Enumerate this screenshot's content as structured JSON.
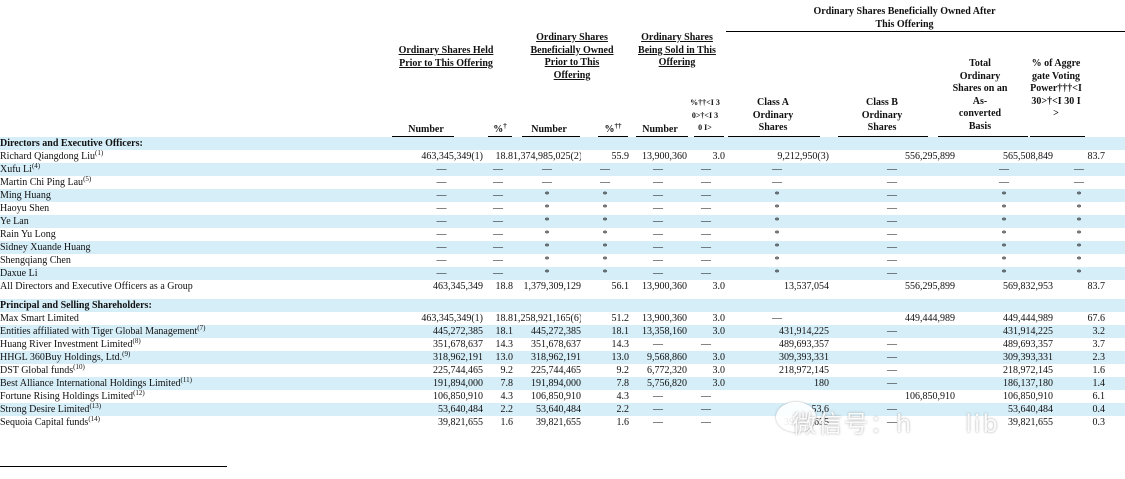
{
  "headers": {
    "group_after": "Ordinary Shares Beneficially Owned After This Offering",
    "held_prior": "Ordinary Shares Held Prior to This Offering",
    "beneficially_owned_prior": "Ordinary Shares Beneficially Owned Prior to This Offering",
    "being_sold": "Ordinary Shares Being Sold in This Offering",
    "number_1": "Number",
    "pct_1": "%",
    "pct_1_mark": "†",
    "number_2": "Number",
    "pct_2": "%",
    "pct_2_mark": "††",
    "number_3": "Number",
    "pct_3": "%††<I 30>†<I 30 I>",
    "class_a": "Class A Ordinary Shares",
    "class_b": "Class B Ordinary Shares",
    "total_asconverted": "Total Ordinary Shares on an As-converted Basis",
    "aggregate_voting": "% of Aggregate Voting Power†††<I 30>†<I 30 I>"
  },
  "sections": {
    "directors": "Directors and Executive Officers:",
    "principal": "Principal and Selling Shareholders:"
  },
  "directors": [
    {
      "name": "Richard Qiangdong Liu",
      "fn": "(1)",
      "c1": "463,345,349(1)",
      "c2": "18.8",
      "c3": "1,374,985,025(2)",
      "c4": "55.9",
      "c5": "13,900,360",
      "c6": "3.0",
      "c7": "9,212,950(3)",
      "c8": "556,295,899",
      "c9": "565,508,849",
      "c10": "83.7"
    },
    {
      "name": "Xufu Li",
      "fn": "(4)",
      "c1": "—",
      "c2": "—",
      "c3": "—",
      "c4": "—",
      "c5": "—",
      "c6": "—",
      "c7": "—",
      "c8": "—",
      "c9": "—",
      "c10": "—"
    },
    {
      "name": "Martin Chi Ping Lau",
      "fn": "(5)",
      "c1": "—",
      "c2": "—",
      "c3": "—",
      "c4": "—",
      "c5": "—",
      "c6": "—",
      "c7": "—",
      "c8": "—",
      "c9": "—",
      "c10": "—"
    },
    {
      "name": "Ming Huang",
      "fn": "",
      "c1": "—",
      "c2": "—",
      "c3": "*",
      "c4": "*",
      "c5": "—",
      "c6": "—",
      "c7": "*",
      "c8": "—",
      "c9": "*",
      "c10": "*"
    },
    {
      "name": "Haoyu Shen",
      "fn": "",
      "c1": "—",
      "c2": "—",
      "c3": "*",
      "c4": "*",
      "c5": "—",
      "c6": "—",
      "c7": "*",
      "c8": "—",
      "c9": "*",
      "c10": "*"
    },
    {
      "name": "Ye Lan",
      "fn": "",
      "c1": "—",
      "c2": "—",
      "c3": "*",
      "c4": "*",
      "c5": "—",
      "c6": "—",
      "c7": "*",
      "c8": "—",
      "c9": "*",
      "c10": "*"
    },
    {
      "name": "Rain Yu Long",
      "fn": "",
      "c1": "—",
      "c2": "—",
      "c3": "*",
      "c4": "*",
      "c5": "—",
      "c6": "—",
      "c7": "*",
      "c8": "—",
      "c9": "*",
      "c10": "*"
    },
    {
      "name": "Sidney Xuande Huang",
      "fn": "",
      "c1": "—",
      "c2": "—",
      "c3": "*",
      "c4": "*",
      "c5": "—",
      "c6": "—",
      "c7": "*",
      "c8": "—",
      "c9": "*",
      "c10": "*"
    },
    {
      "name": "Shengqiang Chen",
      "fn": "",
      "c1": "—",
      "c2": "—",
      "c3": "*",
      "c4": "*",
      "c5": "—",
      "c6": "—",
      "c7": "*",
      "c8": "—",
      "c9": "*",
      "c10": "*"
    },
    {
      "name": "Daxue Li",
      "fn": "",
      "c1": "—",
      "c2": "—",
      "c3": "*",
      "c4": "*",
      "c5": "—",
      "c6": "—",
      "c7": "*",
      "c8": "—",
      "c9": "*",
      "c10": "*"
    },
    {
      "name": "All Directors and Executive Officers as a Group",
      "fn": "",
      "c1": "463,345,349",
      "c2": "18.8",
      "c3": "1,379,309,129",
      "c4": "56.1",
      "c5": "13,900,360",
      "c6": "3.0",
      "c7": "13,537,054",
      "c8": "556,295,899",
      "c9": "569,832,953",
      "c10": "83.7"
    }
  ],
  "principals": [
    {
      "name": "Max Smart Limited",
      "fn": "",
      "c1": "463,345,349(1)",
      "c2": "18.8",
      "c3": "1,258,921,165(6)",
      "c4": "51.2",
      "c5": "13,900,360",
      "c6": "3.0",
      "c7": "—",
      "c8": "449,444,989",
      "c9": "449,444,989",
      "c10": "67.6"
    },
    {
      "name": "Entities affiliated with Tiger Global Management",
      "fn": "(7)",
      "c1": "445,272,385",
      "c2": "18.1",
      "c3": "445,272,385",
      "c4": "18.1",
      "c5": "13,358,160",
      "c6": "3.0",
      "c7": "431,914,225",
      "c8": "—",
      "c9": "431,914,225",
      "c10": "3.2"
    },
    {
      "name": "Huang River Investment Limited",
      "fn": "(8)",
      "c1": "351,678,637",
      "c2": "14.3",
      "c3": "351,678,637",
      "c4": "14.3",
      "c5": "—",
      "c6": "—",
      "c7": "489,693,357",
      "c8": "—",
      "c9": "489,693,357",
      "c10": "3.7"
    },
    {
      "name": "HHGL 360Buy Holdings, Ltd.",
      "fn": "(9)",
      "c1": "318,962,191",
      "c2": "13.0",
      "c3": "318,962,191",
      "c4": "13.0",
      "c5": "9,568,860",
      "c6": "3.0",
      "c7": "309,393,331",
      "c8": "—",
      "c9": "309,393,331",
      "c10": "2.3"
    },
    {
      "name": "DST Global funds",
      "fn": "(10)",
      "c1": "225,744,465",
      "c2": "9.2",
      "c3": "225,744,465",
      "c4": "9.2",
      "c5": "6,772,320",
      "c6": "3.0",
      "c7": "218,972,145",
      "c8": "—",
      "c9": "218,972,145",
      "c10": "1.6"
    },
    {
      "name": "Best Alliance International Holdings Limited",
      "fn": "(11)",
      "c1": "191,894,000",
      "c2": "7.8",
      "c3": "191,894,000",
      "c4": "7.8",
      "c5": "5,756,820",
      "c6": "3.0",
      "c7": "180",
      "c8": "—",
      "c9": "186,137,180",
      "c10": "1.4"
    },
    {
      "name": "Fortune Rising Holdings Limited",
      "fn": "(12)",
      "c1": "106,850,910",
      "c2": "4.3",
      "c3": "106,850,910",
      "c4": "4.3",
      "c5": "—",
      "c6": "—",
      "c7": "",
      "c8": "106,850,910",
      "c9": "106,850,910",
      "c10": "6.1"
    },
    {
      "name": "Strong Desire Limited",
      "fn": "(13)",
      "c1": "53,640,484",
      "c2": "2.2",
      "c3": "53,640,484",
      "c4": "2.2",
      "c5": "—",
      "c6": "—",
      "c7": "53,6",
      "c8": "—",
      "c9": "53,640,484",
      "c10": "0.4"
    },
    {
      "name": "Sequoia Capital funds",
      "fn": "(14)",
      "c1": "39,821,655",
      "c2": "1.6",
      "c3": "39,821,655",
      "c4": "1.6",
      "c5": "—",
      "c6": "—",
      "c7": "39,821,655",
      "c8": "—",
      "c9": "39,821,655",
      "c10": "0.3"
    }
  ],
  "watermark": "微信号：h",
  "watermark_tail": "lib"
}
